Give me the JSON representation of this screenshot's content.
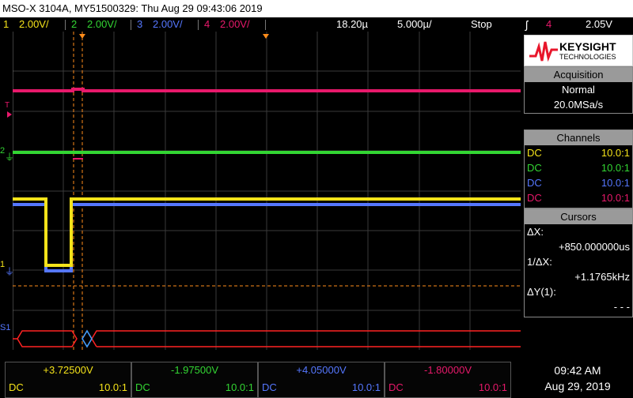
{
  "title": "MSO-X 3104A, MY51500329: Thu Aug 29 09:43:06 2019",
  "status": {
    "ch1_num": "1",
    "ch1_scale": "2.00V/",
    "ch2_num": "2",
    "ch2_scale": "2.00V/",
    "ch3_num": "3",
    "ch3_scale": "2.00V/",
    "ch4_num": "4",
    "ch4_scale": "2.00V/",
    "time_delay": "18.20µ",
    "time_scale": "5.000µ/",
    "run_state": "Stop",
    "trigger_channel": "4",
    "trigger_level": "2.05V"
  },
  "colors": {
    "ch1": "#f5e31a",
    "ch2": "#33d633",
    "ch3": "#5577ff",
    "ch4": "#e8196b",
    "accent": "#ff8c1a",
    "bus": "#ff2222",
    "bus2": "#33a0ff"
  },
  "brand": {
    "name": "KEYSIGHT",
    "sub": "TECHNOLOGIES"
  },
  "acquisition": {
    "header": "Acquisition",
    "mode": "Normal",
    "rate": "20.0MSa/s"
  },
  "channels": {
    "header": "Channels",
    "rows": [
      {
        "coupling": "DC",
        "probe": "10.0:1"
      },
      {
        "coupling": "DC",
        "probe": "10.0:1"
      },
      {
        "coupling": "DC",
        "probe": "10.0:1"
      },
      {
        "coupling": "DC",
        "probe": "10.0:1"
      }
    ]
  },
  "cursors": {
    "header": "Cursors",
    "dx_label": "ΔX:",
    "dx_value": "+850.000000us",
    "inv_label": "1/ΔX:",
    "inv_value": "+1.1765kHz",
    "dy_label": "ΔY(1):",
    "dy_value": "- - -"
  },
  "markers": {
    "t_label": "T",
    "ch1": "1",
    "ch2": "2",
    "bus": "S1"
  },
  "bottom": {
    "ch1_offset": "+3.72500V",
    "ch2_offset": "-1.97500V",
    "ch3_offset": "+4.05000V",
    "ch4_offset": "-1.80000V",
    "coupling": "DC",
    "probe": "10.0:1",
    "time": "09:42 AM",
    "date": "Aug 29, 2019"
  }
}
